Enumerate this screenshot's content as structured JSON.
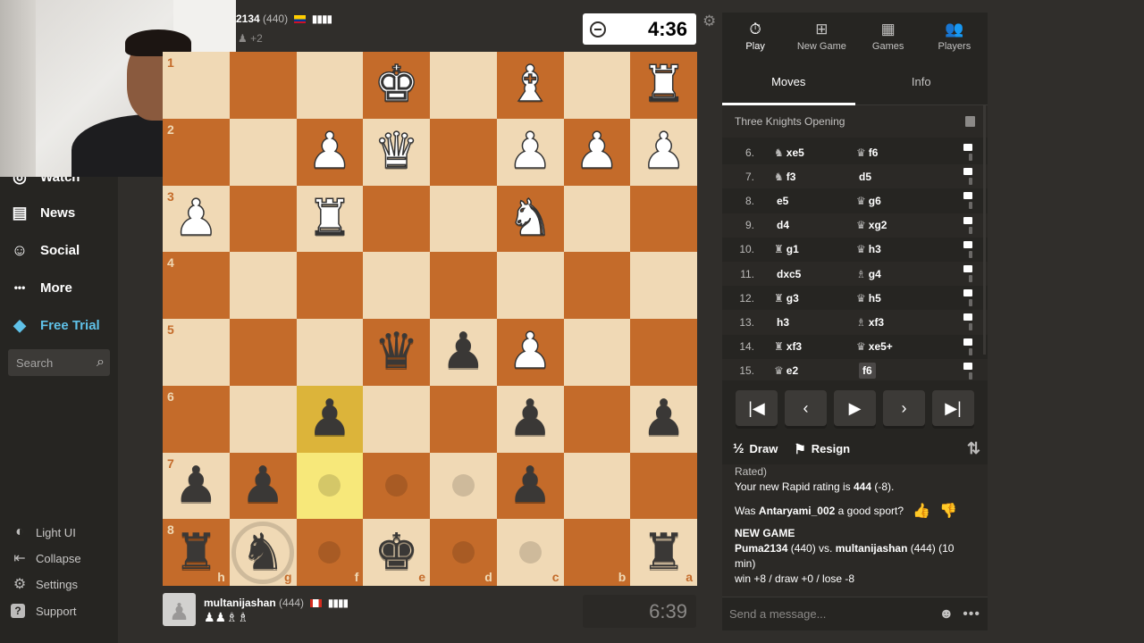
{
  "sidebar": {
    "items": [
      {
        "label": "Watch",
        "icon": "watch-icon",
        "glyph": "◎"
      },
      {
        "label": "News",
        "icon": "news-icon",
        "glyph": "▤"
      },
      {
        "label": "Social",
        "icon": "social-icon",
        "glyph": "☺"
      },
      {
        "label": "More",
        "icon": "more-icon",
        "glyph": "•••"
      },
      {
        "label": "Free Trial",
        "icon": "diamond-icon",
        "glyph": "◆"
      }
    ],
    "search_placeholder": "Search",
    "footer": [
      {
        "label": "Light UI",
        "icon": "light-ui-icon",
        "glyph": "◐"
      },
      {
        "label": "Collapse",
        "icon": "collapse-icon",
        "glyph": "⇤"
      },
      {
        "label": "Settings",
        "icon": "gear-icon",
        "glyph": "⚙"
      },
      {
        "label": "Support",
        "icon": "help-icon",
        "glyph": "?"
      }
    ]
  },
  "top_player": {
    "name": "2134",
    "rating": "(440)",
    "flag": "colombia",
    "captured": "♟ +2"
  },
  "top_clock": "4:36",
  "bottom_player": {
    "name": "multanijashan",
    "rating": "(444)",
    "flag": "canada",
    "captured": "♟♟♗♗"
  },
  "bottom_clock": "6:39",
  "board": {
    "orientation": "black",
    "ranks": [
      "1",
      "2",
      "3",
      "4",
      "5",
      "6",
      "7",
      "8"
    ],
    "files": [
      "h",
      "g",
      "f",
      "e",
      "d",
      "c",
      "b",
      "a"
    ],
    "rows": [
      [
        "",
        "",
        "",
        "wK",
        "",
        "wB",
        "",
        "wR"
      ],
      [
        "",
        "",
        "wP",
        "wQ",
        "",
        "wP",
        "wP",
        "wP"
      ],
      [
        "wP",
        "",
        "wR",
        "",
        "",
        "wN",
        "",
        ""
      ],
      [
        "",
        "",
        "",
        "",
        "",
        "",
        "",
        ""
      ],
      [
        "",
        "",
        "",
        "bQ",
        "bP",
        "wP",
        "",
        ""
      ],
      [
        "",
        "",
        "bP",
        "",
        "",
        "bP",
        "",
        "bP"
      ],
      [
        "bP",
        "bP",
        "",
        "",
        "",
        "bP",
        "",
        ""
      ],
      [
        "bR",
        "bN",
        "",
        "bK",
        "",
        "",
        "",
        "bR"
      ]
    ],
    "highlights": [
      "5-2",
      "6-2"
    ],
    "dots": [
      "6-2",
      "6-3",
      "6-4",
      "7-2",
      "7-4",
      "7-5"
    ],
    "rings": [
      "7-1"
    ]
  },
  "panel": {
    "nav": [
      {
        "label": "Play",
        "icon": "play-clock-icon",
        "glyph": "⏱",
        "active": true
      },
      {
        "label": "New Game",
        "icon": "new-game-icon",
        "glyph": "⊞",
        "active": false
      },
      {
        "label": "Games",
        "icon": "games-icon",
        "glyph": "▦",
        "active": false
      },
      {
        "label": "Players",
        "icon": "players-icon",
        "glyph": "👥",
        "active": false
      }
    ],
    "tabs": [
      "Moves",
      "Info"
    ],
    "opening": "Three Knights Opening",
    "moves": [
      {
        "num": "6.",
        "white": "xe5",
        "wp": "♞",
        "black": "f6",
        "bp": "♛"
      },
      {
        "num": "7.",
        "white": "f3",
        "wp": "♞",
        "black": "d5",
        "bp": ""
      },
      {
        "num": "8.",
        "white": "e5",
        "wp": "",
        "black": "g6",
        "bp": "♛"
      },
      {
        "num": "9.",
        "white": "d4",
        "wp": "",
        "black": "xg2",
        "bp": "♛"
      },
      {
        "num": "10.",
        "white": "g1",
        "wp": "♜",
        "black": "h3",
        "bp": "♛"
      },
      {
        "num": "11.",
        "white": "dxc5",
        "wp": "",
        "black": "g4",
        "bp": "♗"
      },
      {
        "num": "12.",
        "white": "g3",
        "wp": "♜",
        "black": "h5",
        "bp": "♛"
      },
      {
        "num": "13.",
        "white": "h3",
        "wp": "",
        "black": "xf3",
        "bp": "♗"
      },
      {
        "num": "14.",
        "white": "xf3",
        "wp": "♜",
        "black": "xe5+",
        "bp": "♛"
      },
      {
        "num": "15.",
        "white": "e2",
        "wp": "♛",
        "black": "f6",
        "bp": ""
      }
    ],
    "controls": [
      {
        "name": "first-move-button",
        "glyph": "|◀"
      },
      {
        "name": "prev-move-button",
        "glyph": "‹"
      },
      {
        "name": "play-button",
        "glyph": "▶"
      },
      {
        "name": "next-move-button",
        "glyph": "›"
      },
      {
        "name": "last-move-button",
        "glyph": "▶|"
      }
    ],
    "draw_label": "Draw",
    "draw_glyph": "½",
    "resign_label": "Resign",
    "chat": {
      "line1": "Rated)",
      "rating_prefix": "Your new Rapid rating is ",
      "rating_value": "444",
      "rating_suffix": " (-8).",
      "sport_prefix": "Was ",
      "sport_name": "Antaryami_002",
      "sport_suffix": " a good sport?",
      "new_game": "NEW GAME",
      "game_white": "Puma2134",
      "game_mid": " (440) vs. ",
      "game_black": "multanijashan",
      "game_tail": " (444) (10 min)",
      "score": "win +8 / draw +0 / lose -8"
    },
    "chat_placeholder": "Send a message..."
  }
}
